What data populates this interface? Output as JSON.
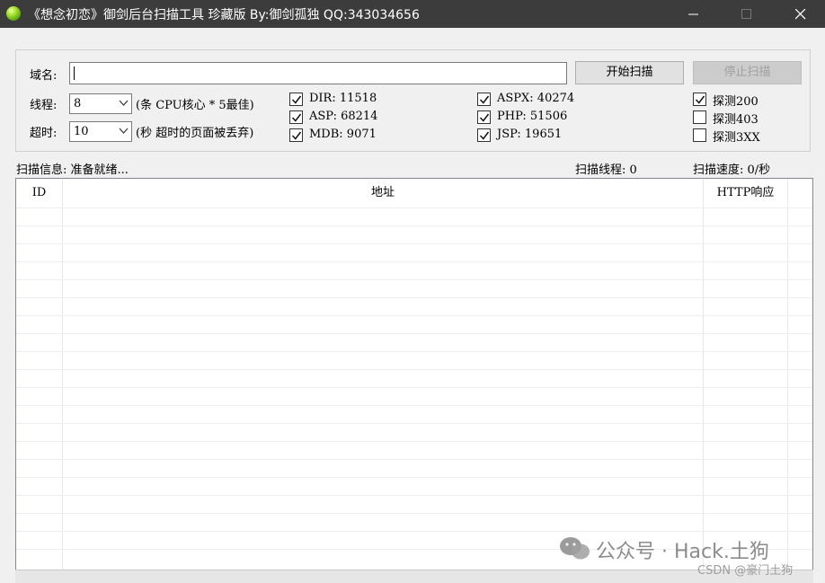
{
  "window": {
    "title": "《想念初恋》御剑后台扫描工具 珍藏版 By:御剑孤独 QQ:343034656",
    "controls": [
      "minimize-icon",
      "maximize-icon",
      "close-icon"
    ]
  },
  "form": {
    "domain_label": "域名:",
    "domain_value": "",
    "threads_label": "线程:",
    "threads_value": "8",
    "threads_hint": "(条 CPU核心 * 5最佳)",
    "timeout_label": "超时:",
    "timeout_value": "10",
    "timeout_hint": "(秒 超时的页面被丢弃)",
    "start_button": "开始扫描",
    "stop_button": "停止扫描"
  },
  "dictionaries": [
    {
      "label": "DIR: 11518",
      "checked": true
    },
    {
      "label": "ASP: 68214",
      "checked": true
    },
    {
      "label": "MDB: 9071",
      "checked": true
    },
    {
      "label": "ASPX: 40274",
      "checked": true
    },
    {
      "label": "PHP: 51506",
      "checked": true
    },
    {
      "label": "JSP: 19651",
      "checked": true
    }
  ],
  "detect": [
    {
      "label": "探测200",
      "checked": true
    },
    {
      "label": "探测403",
      "checked": false
    },
    {
      "label": "探测3XX",
      "checked": false
    }
  ],
  "status": {
    "info": "扫描信息: 准备就绪...",
    "threads": "扫描线程: 0",
    "speed": "扫描速度: 0/秒"
  },
  "table": {
    "columns": [
      "ID",
      "地址",
      "HTTP响应"
    ],
    "rows": []
  },
  "watermark": {
    "text": "公众号 · Hack.土狗",
    "source": "CSDN @豪门土狗"
  }
}
